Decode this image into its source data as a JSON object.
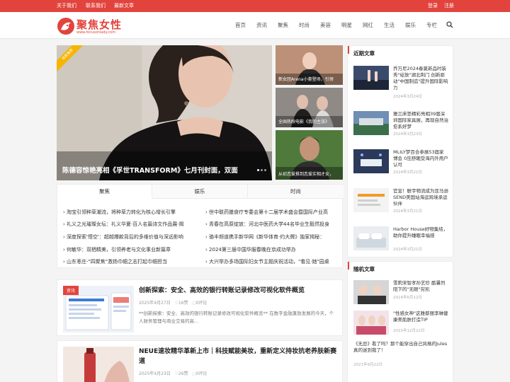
{
  "topbar": {
    "links": [
      "关于我们",
      "联系我们",
      "最新文章"
    ],
    "login": "登录",
    "register": "注册"
  },
  "header": {
    "logo_text": "聚焦女性",
    "logo_sub": "www.focusonlady.com",
    "nav": [
      "首页",
      "资讯",
      "聚焦",
      "时尚",
      "美容",
      "明星",
      "网红",
      "生活",
      "娱乐",
      "专栏"
    ]
  },
  "hero": {
    "ribbon": "独家推荐",
    "title": "陈德容惊艳亮相《孚世TRANSFORM》七月刊封面，双面"
  },
  "side_images": [
    {
      "caption": "新女团Arena小豪登场，引领"
    },
    {
      "caption": "全国热映电影《我的主张》"
    },
    {
      "caption": "从初恋爱推到恋爱实相才女，"
    }
  ],
  "tabs": {
    "labels": [
      "聚焦",
      "娱乐",
      "时尚"
    ],
    "left_items": [
      "淘宝引领种草潮流，将种草力转化为核心增长引擎",
      "礼义之光璀璨女坛：礼义华夏·百人名篇诗文作品展·揭",
      "深度探索'悟空'：超越爆款背后的多维价值与深远影响",
      "何敏华：双栖精美，引领养老与文化事业新篇章",
      "山东枣庄-\"四聚焦\"激扬巾帼之志打起巾帼担当"
    ],
    "right_items": [
      "世中联药膳食疗专委会第十二届学术盛会暨国际产业高",
      "青春在高原绽放：河北中医药大学44名毕业生毅然投身",
      "骆丰频道携手新华网《新华体育·约大牌》独家揭秘：",
      "2024第三届中国华服春晚在京成功举办",
      "大兴举办多场国际妇女节主题庆祝活动，\"看见·她\"园桌"
    ]
  },
  "articles": [
    {
      "tag": "资讯",
      "title": "创新探索：安全、高效的银行转账记录修改可视化软件概览",
      "date": "2025年4月27日",
      "likes": "16赞",
      "comments": "0评论",
      "desc": "**创新探索：安全、高效的银行转账记录修改可视化软件概览** 在数字金融蓬勃发展的今天，个人财务管理与商业交易的高..."
    },
    {
      "tag": "",
      "title": "NEUE速妆精华革新上市｜科技赋能美妆，重新定义持妆抗老养肤新赛道",
      "date": "2025年4月23日",
      "likes": "26赞",
      "comments": "0评论",
      "desc": ""
    }
  ],
  "sidebar": {
    "recent_title": "近期文章",
    "recent": [
      {
        "title": "乔万尼2024春夏新品时装秀\"绽放\"湖北荆门 创新驱动\"中国制造\"提升国际影响力",
        "date": "2024年3月24日"
      },
      {
        "title": "雅兰床垫精彩亮相39届深圳国际家具展，再现自然治愈系好梦",
        "date": "2024年3月23日"
      },
      {
        "title": "MLILY梦百合参展53届家博会 0压舒眠受海内外用户认可",
        "date": "2024年3月21日"
      },
      {
        "title": "官宣！联宇物流成为亚马逊SEND美国站海运跨境承运伙伴",
        "date": "2024年3月21日"
      },
      {
        "title": "Harbor House好物集结，助你提升睡眠幸福感",
        "date": "2024年3月21日"
      }
    ],
    "random_title": "随机文章",
    "random": [
      {
        "title": "雪莉宋智孝孙艺珍 酷暑烈阳下的\"无眼\"穷凯",
        "date": "2016年6月12日"
      },
      {
        "title": "\"性感女神\"这雅蔡丽李琳健康美肌肤打造TIP",
        "date": "2015年12月22日"
      },
      {
        "title": "《无忌》看了吗？那个能穿出自己风格的Jules真的迷到我了！",
        "date": "2021年9月22日"
      }
    ]
  },
  "colors": {
    "accent": "#e2443d"
  }
}
